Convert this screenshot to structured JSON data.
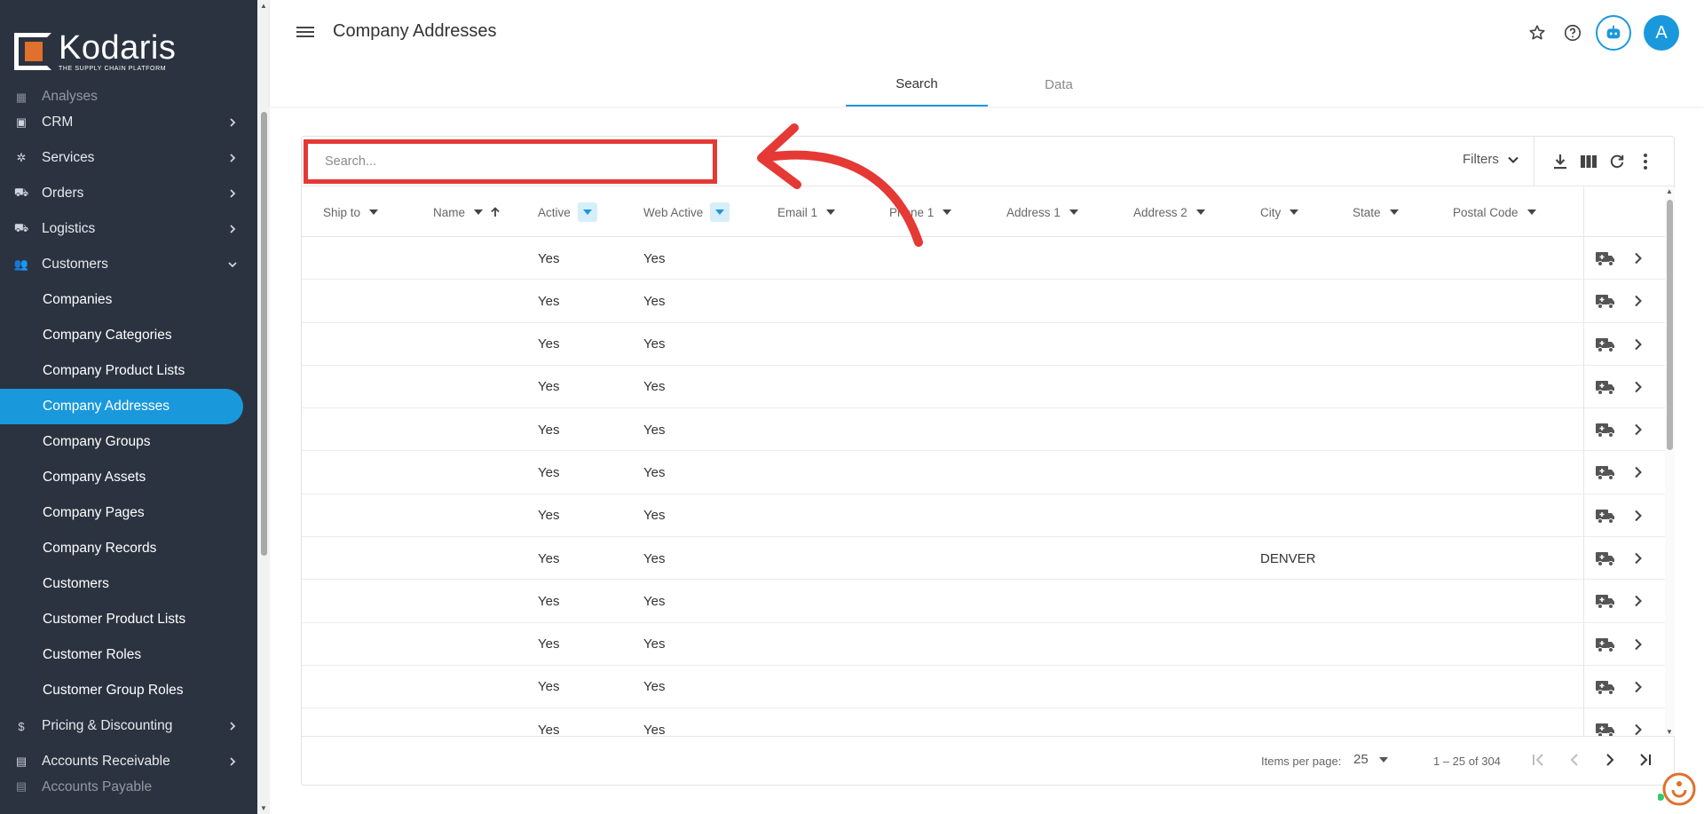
{
  "brand": {
    "name": "Kodaris",
    "tagline": "THE SUPPLY CHAIN PLATFORM",
    "accent": "#1a98dc",
    "logo_color": "#e0702b",
    "sidebar_bg": "#2b3340",
    "annotation_color": "#e53935"
  },
  "sidebar": {
    "partial_top_label": "Analyses",
    "items": [
      {
        "label": "CRM",
        "icon": "id-card-icon"
      },
      {
        "label": "Services",
        "icon": "gears-icon"
      },
      {
        "label": "Orders",
        "icon": "truck-icon"
      },
      {
        "label": "Logistics",
        "icon": "shipping-icon"
      },
      {
        "label": "Customers",
        "icon": "users-icon",
        "expanded": true
      }
    ],
    "sub_items": [
      "Companies",
      "Company Categories",
      "Company Product Lists",
      "Company Addresses",
      "Company Groups",
      "Company Assets",
      "Company Pages",
      "Company Records",
      "Customers",
      "Customer Product Lists",
      "Customer Roles",
      "Customer Group Roles"
    ],
    "active_sub_item": "Company Addresses",
    "after_items": [
      {
        "label": "Pricing & Discounting",
        "icon": "dollar-icon"
      },
      {
        "label": "Accounts Receivable",
        "icon": "receivable-icon"
      }
    ],
    "partial_bottom_label": "Accounts Payable"
  },
  "header": {
    "title": "Company Addresses",
    "avatar_initial": "A",
    "tabs": [
      {
        "label": "Search",
        "active": true
      },
      {
        "label": "Data",
        "active": false
      }
    ]
  },
  "toolbar": {
    "search_placeholder": "Search...",
    "filters_label": "Filters"
  },
  "table": {
    "columns": [
      "Ship to",
      "Name",
      "Active",
      "Web Active",
      "Email 1",
      "Phone 1",
      "Address 1",
      "Address 2",
      "City",
      "State",
      "Postal Code"
    ],
    "rows": [
      {
        "ship_to": "",
        "name": "",
        "active": "Yes",
        "web_active": "Yes",
        "email1": "",
        "phone1": "",
        "address1": "",
        "address2": "",
        "city": "",
        "state": "",
        "postal_code": ""
      },
      {
        "ship_to": "",
        "name": "",
        "active": "Yes",
        "web_active": "Yes",
        "email1": "",
        "phone1": "",
        "address1": "",
        "address2": "",
        "city": "",
        "state": "",
        "postal_code": ""
      },
      {
        "ship_to": "",
        "name": "",
        "active": "Yes",
        "web_active": "Yes",
        "email1": "",
        "phone1": "",
        "address1": "",
        "address2": "",
        "city": "",
        "state": "",
        "postal_code": ""
      },
      {
        "ship_to": "",
        "name": "",
        "active": "Yes",
        "web_active": "Yes",
        "email1": "",
        "phone1": "",
        "address1": "",
        "address2": "",
        "city": "",
        "state": "",
        "postal_code": ""
      },
      {
        "ship_to": "",
        "name": "",
        "active": "Yes",
        "web_active": "Yes",
        "email1": "",
        "phone1": "",
        "address1": "",
        "address2": "",
        "city": "",
        "state": "",
        "postal_code": ""
      },
      {
        "ship_to": "",
        "name": "",
        "active": "Yes",
        "web_active": "Yes",
        "email1": "",
        "phone1": "",
        "address1": "",
        "address2": "",
        "city": "",
        "state": "",
        "postal_code": ""
      },
      {
        "ship_to": "",
        "name": "",
        "active": "Yes",
        "web_active": "Yes",
        "email1": "",
        "phone1": "",
        "address1": "",
        "address2": "",
        "city": "",
        "state": "",
        "postal_code": ""
      },
      {
        "ship_to": "",
        "name": "",
        "active": "Yes",
        "web_active": "Yes",
        "email1": "",
        "phone1": "",
        "address1": "",
        "address2": "",
        "city": "DENVER",
        "state": "",
        "postal_code": ""
      },
      {
        "ship_to": "",
        "name": "",
        "active": "Yes",
        "web_active": "Yes",
        "email1": "",
        "phone1": "",
        "address1": "",
        "address2": "",
        "city": "",
        "state": "",
        "postal_code": ""
      },
      {
        "ship_to": "",
        "name": "",
        "active": "Yes",
        "web_active": "Yes",
        "email1": "",
        "phone1": "",
        "address1": "",
        "address2": "",
        "city": "",
        "state": "",
        "postal_code": ""
      },
      {
        "ship_to": "",
        "name": "",
        "active": "Yes",
        "web_active": "Yes",
        "email1": "",
        "phone1": "",
        "address1": "",
        "address2": "",
        "city": "",
        "state": "",
        "postal_code": ""
      },
      {
        "ship_to": "",
        "name": "",
        "active": "Yes",
        "web_active": "Yes",
        "email1": "",
        "phone1": "",
        "address1": "",
        "address2": "",
        "city": "",
        "state": "",
        "postal_code": ""
      }
    ]
  },
  "pagination": {
    "items_per_page_label": "Items per page:",
    "items_per_page": "25",
    "range_label": "1 – 25 of 304"
  }
}
